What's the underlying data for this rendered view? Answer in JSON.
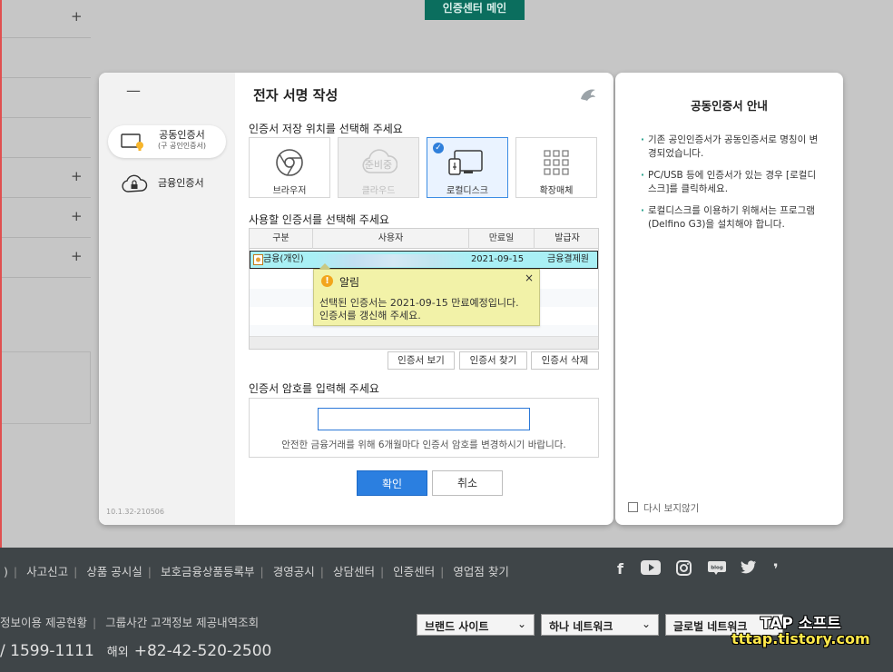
{
  "background": {
    "top_tab": "인증센터 메인",
    "footer_links": [
      "사고신고",
      "상품 공시실",
      "보호금융상품등록부",
      "경영공시",
      "상담센터",
      "인증센터",
      "영업점 찾기"
    ],
    "footer_link_prefix": ")",
    "footer_info": [
      "정보이용 제공현황",
      "그룹사간 고객정보 제공내역조회"
    ],
    "phone_domestic": "/ 1599-1111",
    "phone_overseas_label": "해외",
    "phone_overseas": "+82-42-520-2500",
    "selects": [
      "브랜드 사이트",
      "하나 네트워크",
      "글로벌 네트워크"
    ],
    "social_icons": [
      "facebook-icon",
      "youtube-icon",
      "instagram-icon",
      "blog-icon",
      "twitter-icon",
      "post-icon"
    ],
    "watermark_1": "TAP 소프트",
    "watermark_2": "tttap.tistory.com"
  },
  "dialog": {
    "nav": {
      "items": [
        {
          "label": "공동인증서",
          "sub": "(구 공인인증서)"
        },
        {
          "label": "금융인증서",
          "sub": ""
        }
      ],
      "version": "10.1.32-210506"
    },
    "title": "전자 서명 작성",
    "location_prompt": "인증서 저장 위치를 선택해 주세요",
    "locations": [
      {
        "label": "브라우저",
        "state": "normal"
      },
      {
        "label": "클라우드",
        "badge": "준비중",
        "state": "disabled"
      },
      {
        "label": "로컬디스크",
        "state": "selected"
      },
      {
        "label": "확장매체",
        "state": "normal"
      }
    ],
    "cert_prompt": "사용할 인증서를 선택해 주세요",
    "table": {
      "headers": [
        "구분",
        "사용자",
        "만료일",
        "발급자"
      ],
      "rows": [
        {
          "type": "금융(개인)",
          "user": "",
          "expiry": "2021-09-15",
          "issuer": "금융결제원"
        }
      ]
    },
    "tooltip": {
      "title": "알림",
      "close": "×",
      "line1": "선택된 인증서는 2021-09-15 만료예정입니다.",
      "line2": "인증서를 갱신해 주세요."
    },
    "cert_buttons": [
      "인증서 보기",
      "인증서 찾기",
      "인증서 삭제"
    ],
    "password_prompt": "인증서 암호를 입력해 주세요",
    "password_value": "",
    "password_hint": "안전한 금융거래를 위해 6개월마다 인증서 암호를 변경하시기 바랍니다.",
    "ok": "확인",
    "cancel": "취소"
  },
  "info": {
    "title": "공동인증서 안내",
    "items": [
      "기존 공인인증서가 공동인증서로 명칭이 변경되었습니다.",
      "PC/USB 등에 인증서가 있는 경우 [로컬디스크]를 클릭하세요.",
      "로컬디스크를 이용하기 위해서는 프로그램(Delfino G3)을 설치해야 합니다."
    ],
    "dont_show": "다시 보지않기"
  }
}
